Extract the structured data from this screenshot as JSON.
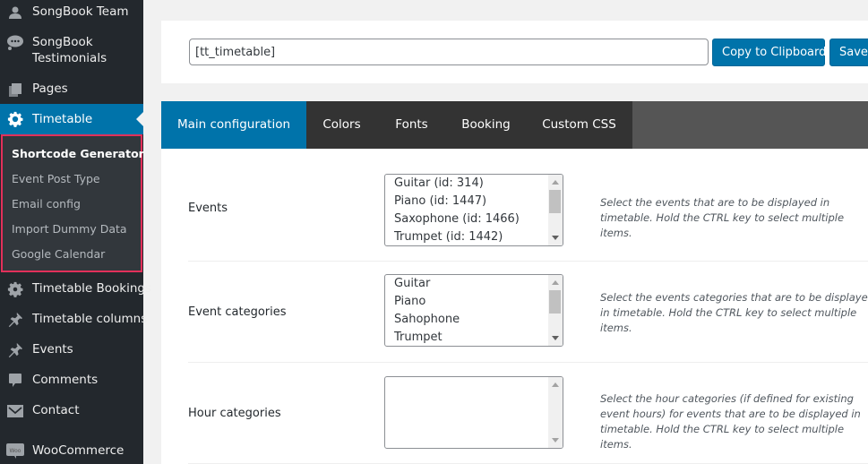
{
  "sidebar": {
    "items": [
      {
        "label": "SongBook Team",
        "icon": "user-icon"
      },
      {
        "label": "SongBook Testimonials",
        "icon": "speech-bubble-icon"
      },
      {
        "label": "Pages",
        "icon": "pages-icon"
      },
      {
        "label": "Timetable",
        "icon": "gear-icon",
        "active": true
      },
      {
        "label": "Timetable Bookings",
        "icon": "gear-icon"
      },
      {
        "label": "Timetable columns",
        "icon": "pin-icon"
      },
      {
        "label": "Events",
        "icon": "pin-icon"
      },
      {
        "label": "Comments",
        "icon": "comment-icon"
      },
      {
        "label": "Contact",
        "icon": "envelope-icon"
      },
      {
        "label": "WooCommerce",
        "icon": "woocommerce-icon"
      }
    ],
    "songbook_team": "SongBook Team",
    "songbook_testimonials_line1": "SongBook",
    "songbook_testimonials_line2": "Testimonials",
    "pages": "Pages",
    "timetable": "Timetable",
    "timetable_bookings": "Timetable Bookings",
    "timetable_columns": "Timetable columns",
    "events": "Events",
    "comments": "Comments",
    "contact": "Contact",
    "woocommerce": "WooCommerce",
    "woo_icon_text": "Woo",
    "submenu": [
      "Shortcode Generator",
      "Event Post Type",
      "Email config",
      "Import Dummy Data",
      "Google Calendar"
    ],
    "submenu_current": "Shortcode Generator"
  },
  "shortcode": {
    "value": "[tt_timetable]",
    "copy_label": "Copy to Clipboard",
    "save_label": "Save"
  },
  "tabs": [
    "Main configuration",
    "Colors",
    "Fonts",
    "Booking",
    "Custom CSS"
  ],
  "active_tab": "Main configuration",
  "colors": {
    "accent": "#0073aa",
    "sidebar_bg": "#23282d",
    "submenu_highlight": "#e2305a"
  },
  "fields": {
    "events": {
      "label": "Events",
      "options": [
        "Guitar (id: 314)",
        "Piano (id: 1447)",
        "Saxophone (id: 1466)",
        "Trumpet (id: 1442)"
      ],
      "description": "Select the events that are to be displayed in timetable. Hold the CTRL key to select multiple items."
    },
    "event_categories": {
      "label": "Event categories",
      "options": [
        "Guitar",
        "Piano",
        "Sahophone",
        "Trumpet"
      ],
      "description": "Select the events categories that are to be displayed in timetable. Hold the CTRL key to select multiple items."
    },
    "hour_categories": {
      "label": "Hour categories",
      "options": [],
      "description": "Select the hour categories (if defined for existing event hours) for events that are to be displayed in timetable. Hold the CTRL key to select multiple items."
    }
  }
}
